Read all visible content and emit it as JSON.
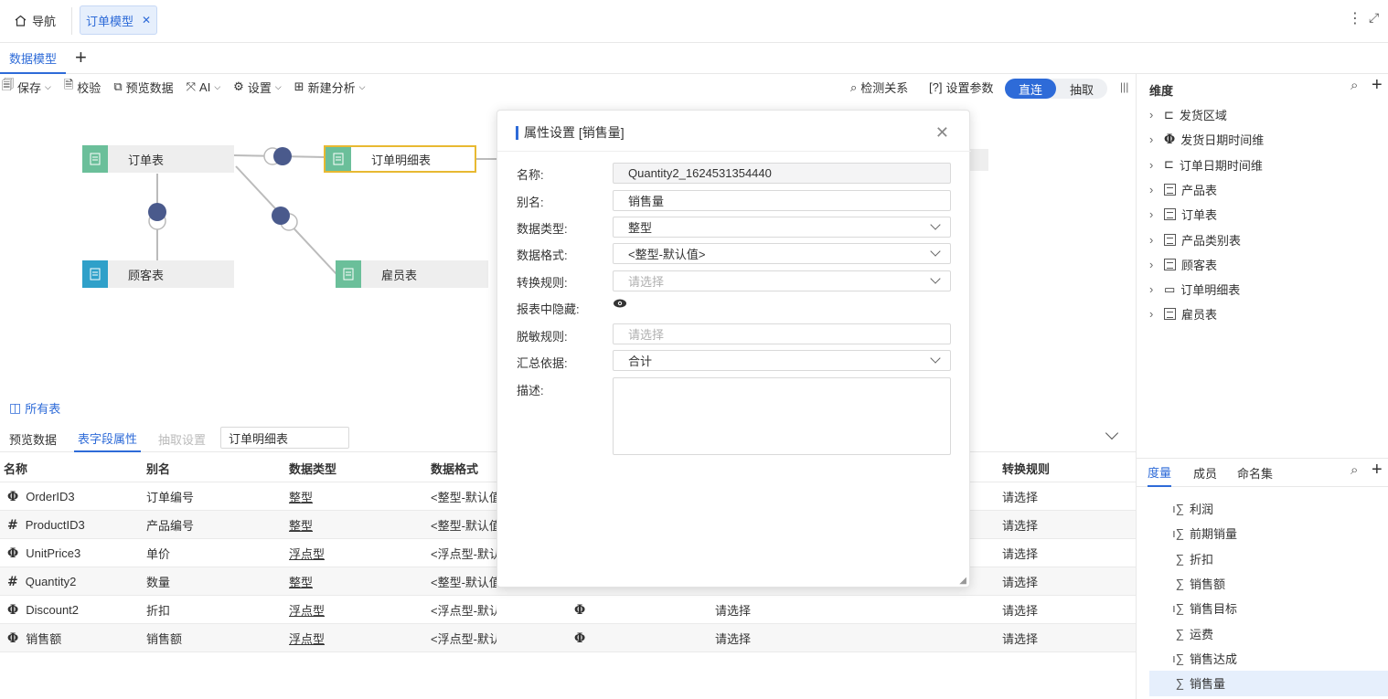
{
  "topbar": {
    "nav_label": "导航",
    "active_tab": "订单模型"
  },
  "model_tabs": {
    "active": "数据模型",
    "add": "+"
  },
  "toolbar": {
    "save": "保存",
    "check": "校验",
    "preview": "预览数据",
    "ai": "AI",
    "settings": "设置",
    "new_analysis": "新建分析",
    "detect": "检测关系",
    "params": "设置参数",
    "mode_direct": "直连",
    "mode_extract": "抽取"
  },
  "diagram": {
    "nodes": [
      "订单表",
      "订单明细表",
      "顾客表",
      "雇员表"
    ],
    "all_tables": "所有表"
  },
  "bottom": {
    "tabs": [
      "预览数据",
      "表字段属性",
      "抽取设置"
    ],
    "table_input": "订单明细表",
    "headers": [
      "名称",
      "别名",
      "数据类型",
      "数据格式",
      "转换规则"
    ],
    "rows": [
      {
        "icon": "Φ",
        "name": "OrderID3",
        "alias": "订单编号",
        "type": "整型",
        "format": "<整型-默认值",
        "col5": "",
        "col6": "",
        "rule": "请选择"
      },
      {
        "icon": "#",
        "name": "ProductID3",
        "alias": "产品编号",
        "type": "整型",
        "format": "<整型-默认值",
        "col5": "",
        "col6": "",
        "rule": "请选择"
      },
      {
        "icon": "Φ",
        "name": "UnitPrice3",
        "alias": "单价",
        "type": "浮点型",
        "format": "<浮点型-默认",
        "col5": "",
        "col6": "",
        "rule": "请选择"
      },
      {
        "icon": "#",
        "name": "Quantity2",
        "alias": "数量",
        "type": "整型",
        "format": "<整型-默认值",
        "col5": "",
        "col6": "",
        "rule": "请选择"
      },
      {
        "icon": "Φ",
        "name": "Discount2",
        "alias": "折扣",
        "type": "浮点型",
        "format": "<浮点型-默认值>",
        "col5": "Φ",
        "col6": "请选择",
        "rule": "请选择"
      },
      {
        "icon": "Φ",
        "name": "销售额",
        "alias": "销售额",
        "type": "浮点型",
        "format": "<浮点型-默认值>",
        "col5": "Φ",
        "col6": "请选择",
        "rule": "请选择"
      }
    ]
  },
  "dialog": {
    "title": "属性设置 [销售量]",
    "fields": {
      "name_label": "名称:",
      "name_value": "Quantity2_1624531354440",
      "alias_label": "别名:",
      "alias_value": "销售量",
      "type_label": "数据类型:",
      "type_value": "整型",
      "format_label": "数据格式:",
      "format_value": "<整型-默认值>",
      "rule_label": "转换规则:",
      "rule_placeholder": "请选择",
      "hide_label": "报表中隐藏:",
      "mask_label": "脱敏规则:",
      "mask_placeholder": "请选择",
      "agg_label": "汇总依据:",
      "agg_value": "合计",
      "desc_label": "描述:"
    }
  },
  "right_panel": {
    "dim_title": "维度",
    "dimensions": [
      {
        "label": "发货区域",
        "icon": "hierarchy-icon"
      },
      {
        "label": "发货日期时间维",
        "icon": "date-dim-icon"
      },
      {
        "label": "订单日期时间维",
        "icon": "hierarchy-icon"
      },
      {
        "label": "产品表",
        "icon": "table-icon"
      },
      {
        "label": "订单表",
        "icon": "table-icon"
      },
      {
        "label": "产品类别表",
        "icon": "table-edit-icon"
      },
      {
        "label": "顾客表",
        "icon": "table-icon"
      },
      {
        "label": "订单明细表",
        "icon": "folder-icon"
      },
      {
        "label": "雇员表",
        "icon": "table-icon"
      }
    ],
    "measure_tabs": [
      "度量",
      "成员",
      "命名集"
    ],
    "measures": [
      {
        "label": "利润",
        "calc": true
      },
      {
        "label": "前期销量",
        "calc": true
      },
      {
        "label": "折扣",
        "calc": false
      },
      {
        "label": "销售额",
        "calc": false
      },
      {
        "label": "销售目标",
        "calc": true
      },
      {
        "label": "运费",
        "calc": false
      },
      {
        "label": "销售达成",
        "calc": true
      },
      {
        "label": "销售量",
        "calc": false
      }
    ]
  },
  "colors": {
    "accent": "#2e6bd8",
    "highlight": "#e02020",
    "node_green": "#6bbf9a",
    "node_blue": "#2fa0c9",
    "connector": "#4a5a8c"
  }
}
